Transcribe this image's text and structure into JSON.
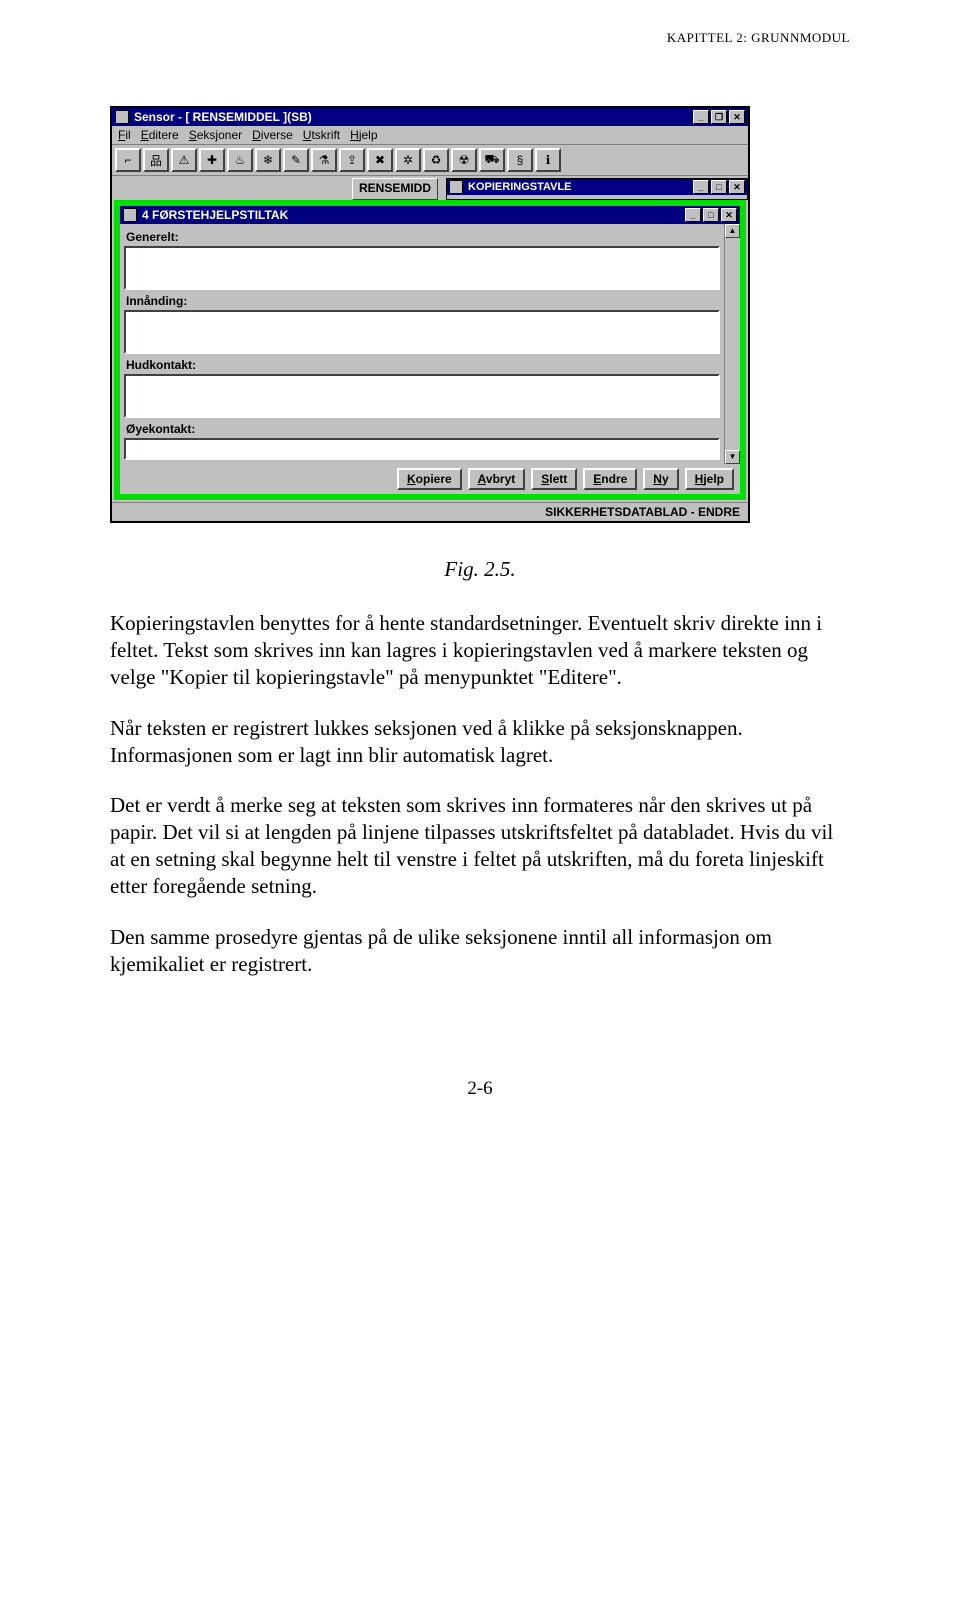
{
  "running_header": "KAPITTEL 2: GRUNNMODUL",
  "app": {
    "title": "Sensor - [ RENSEMIDDEL ](SB)",
    "menu": [
      "Fil",
      "Editere",
      "Seksjoner",
      "Diverse",
      "Utskrift",
      "Hjelp"
    ],
    "toolbar_icons": [
      "key-icon",
      "org-icon",
      "warning-icon",
      "plus-icon",
      "fire-icon",
      "drop-icon",
      "tools-icon",
      "flask-icon",
      "crane-icon",
      "x-icon",
      "tree-icon",
      "trash-icon",
      "waste-icon",
      "truck-icon",
      "paragraph-icon",
      "info-icon"
    ],
    "doc_label": "RENSEMIDD",
    "kopieringstavle_title": "KOPIERINGSTAVLE",
    "section_title": "4 FØRSTEHJELPSTILTAK",
    "fields": [
      {
        "label": "Generelt:",
        "value": ""
      },
      {
        "label": "Innånding:",
        "value": ""
      },
      {
        "label": "Hudkontakt:",
        "value": ""
      },
      {
        "label": "Øyekontakt:",
        "value": ""
      }
    ],
    "buttons": [
      "Kopiere",
      "Avbryt",
      "Slett",
      "Endre",
      "Ny",
      "Hjelp"
    ],
    "status": "SIKKERHETSDATABLAD - ENDRE"
  },
  "caption": "Fig. 2.5.",
  "paragraphs": [
    "Kopieringstavlen benyttes for å hente standardsetninger. Eventuelt skriv direkte inn i feltet. Tekst som skrives inn kan lagres i kopieringstavlen ved å markere teksten og velge \"Kopier til kopieringstavle\" på menypunktet \"Editere\".",
    "Når teksten er registrert lukkes seksjonen ved å klikke på seksjonsknappen. Informasjonen som er lagt inn blir automatisk lagret.",
    "Det er verdt å merke seg at teksten som skrives inn formateres når den skrives ut på papir. Det vil si at lengden på linjene tilpasses utskriftsfeltet på databladet. Hvis du vil at en setning skal begynne helt til venstre i feltet på utskriften, må du foreta linjeskift etter foregående setning.",
    "Den samme prosedyre gjentas på de ulike seksjonene inntil all informasjon om kjemikaliet er registrert."
  ],
  "page_number": "2-6",
  "glyphs": {
    "key-icon": "⌐",
    "org-icon": "品",
    "warning-icon": "⚠",
    "plus-icon": "✚",
    "fire-icon": "♨",
    "drop-icon": "❄",
    "tools-icon": "✎",
    "flask-icon": "⚗",
    "crane-icon": "⇪",
    "x-icon": "✖",
    "tree-icon": "✲",
    "trash-icon": "♻",
    "waste-icon": "☢",
    "truck-icon": "⛟",
    "paragraph-icon": "§",
    "info-icon": "ℹ"
  }
}
